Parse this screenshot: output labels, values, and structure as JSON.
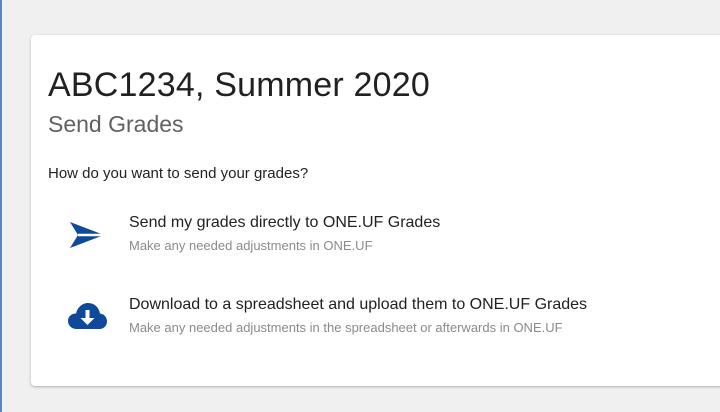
{
  "course": {
    "title": "ABC1234, Summer 2020",
    "subtitle": "Send Grades"
  },
  "prompt": "How do you want to send your grades?",
  "options": [
    {
      "label": "Send my grades directly to ONE.UF Grades",
      "description": "Make any needed adjustments in ONE.UF",
      "icon": "send-icon"
    },
    {
      "label": "Download to a spreadsheet and upload them to ONE.UF Grades",
      "description": "Make any needed adjustments in the spreadsheet or afterwards in ONE.UF",
      "icon": "cloud-download-icon"
    }
  ],
  "colors": {
    "icon_accent": "#0f4a9a",
    "page_background": "#f0f0f0",
    "card_background": "#ffffff",
    "frame_border": "#5a86bd"
  }
}
